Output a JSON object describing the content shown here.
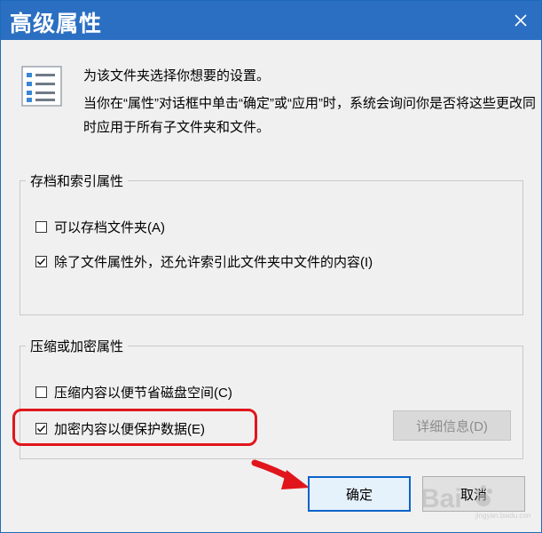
{
  "window": {
    "title": "高级属性"
  },
  "intro": {
    "line1": "为该文件夹选择你想要的设置。",
    "line2": "当你在“属性”对话框中单击“确定”或“应用”时，系统会询问你是否将这些更改同时应用于所有子文件夹和文件。"
  },
  "archive_group": {
    "title": "存档和索引属性",
    "archive_label": "可以存档文件夹(A)",
    "archive_checked": false,
    "index_label": "除了文件属性外，还允许索引此文件夹中文件的内容(I)",
    "index_checked": true
  },
  "compress_group": {
    "title": "压缩或加密属性",
    "compress_label": "压缩内容以便节省磁盘空间(C)",
    "compress_checked": false,
    "encrypt_label": "加密内容以便保护数据(E)",
    "encrypt_checked": true,
    "details_label": "详细信息(D)"
  },
  "buttons": {
    "ok_label": "确定",
    "cancel_label": "取消"
  },
  "watermark": {
    "brand": "Bai",
    "sub": "jingyan.baidu.com"
  },
  "colors": {
    "titlebar": "#2b6fc2",
    "dialog_bg": "#f0f0f0",
    "highlight": "#e0161c",
    "ok_border": "#0a63c9"
  },
  "icons": [
    "close-icon",
    "settings-list-icon",
    "checkbox-checked-icon",
    "red-arrow-icon",
    "baidu-paw-icon"
  ]
}
